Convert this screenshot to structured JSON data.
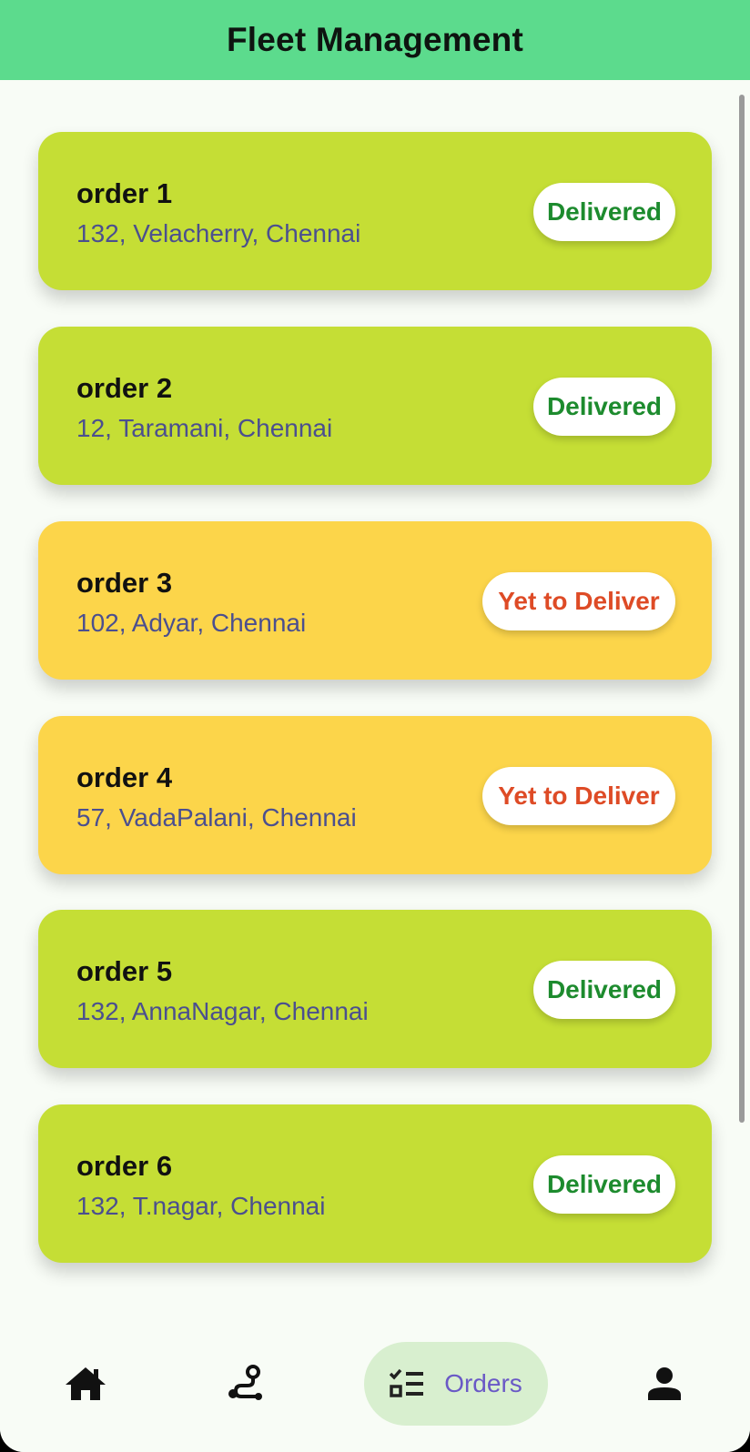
{
  "header": {
    "title": "Fleet Management"
  },
  "orders": [
    {
      "title": "order 1",
      "address": "132, Velacherry, Chennai",
      "status": "Delivered"
    },
    {
      "title": "order 2",
      "address": "12, Taramani, Chennai",
      "status": "Delivered"
    },
    {
      "title": "order 3",
      "address": "102, Adyar, Chennai",
      "status": "Yet to Deliver"
    },
    {
      "title": "order 4",
      "address": "57, VadaPalani, Chennai",
      "status": "Yet to Deliver"
    },
    {
      "title": "order 5",
      "address": "132, AnnaNagar, Chennai",
      "status": "Delivered"
    },
    {
      "title": "order 6",
      "address": "132, T.nagar, Chennai",
      "status": "Delivered"
    }
  ],
  "colors": {
    "app_bar": "#5cdb8d",
    "delivered_card": "#c5de35",
    "pending_card": "#fcd54a",
    "delivered_text": "#1d8b2e",
    "pending_text": "#de4b26",
    "address_text": "#4b4f8f",
    "nav_active_bg": "#d8efcf",
    "nav_active_text": "#6a59c6"
  },
  "bottom_nav": {
    "items": [
      {
        "icon": "home-icon",
        "active": false
      },
      {
        "icon": "route-icon",
        "active": false
      },
      {
        "icon": "checklist-icon",
        "label": "Orders",
        "active": true
      },
      {
        "icon": "person-icon",
        "active": false
      }
    ]
  }
}
